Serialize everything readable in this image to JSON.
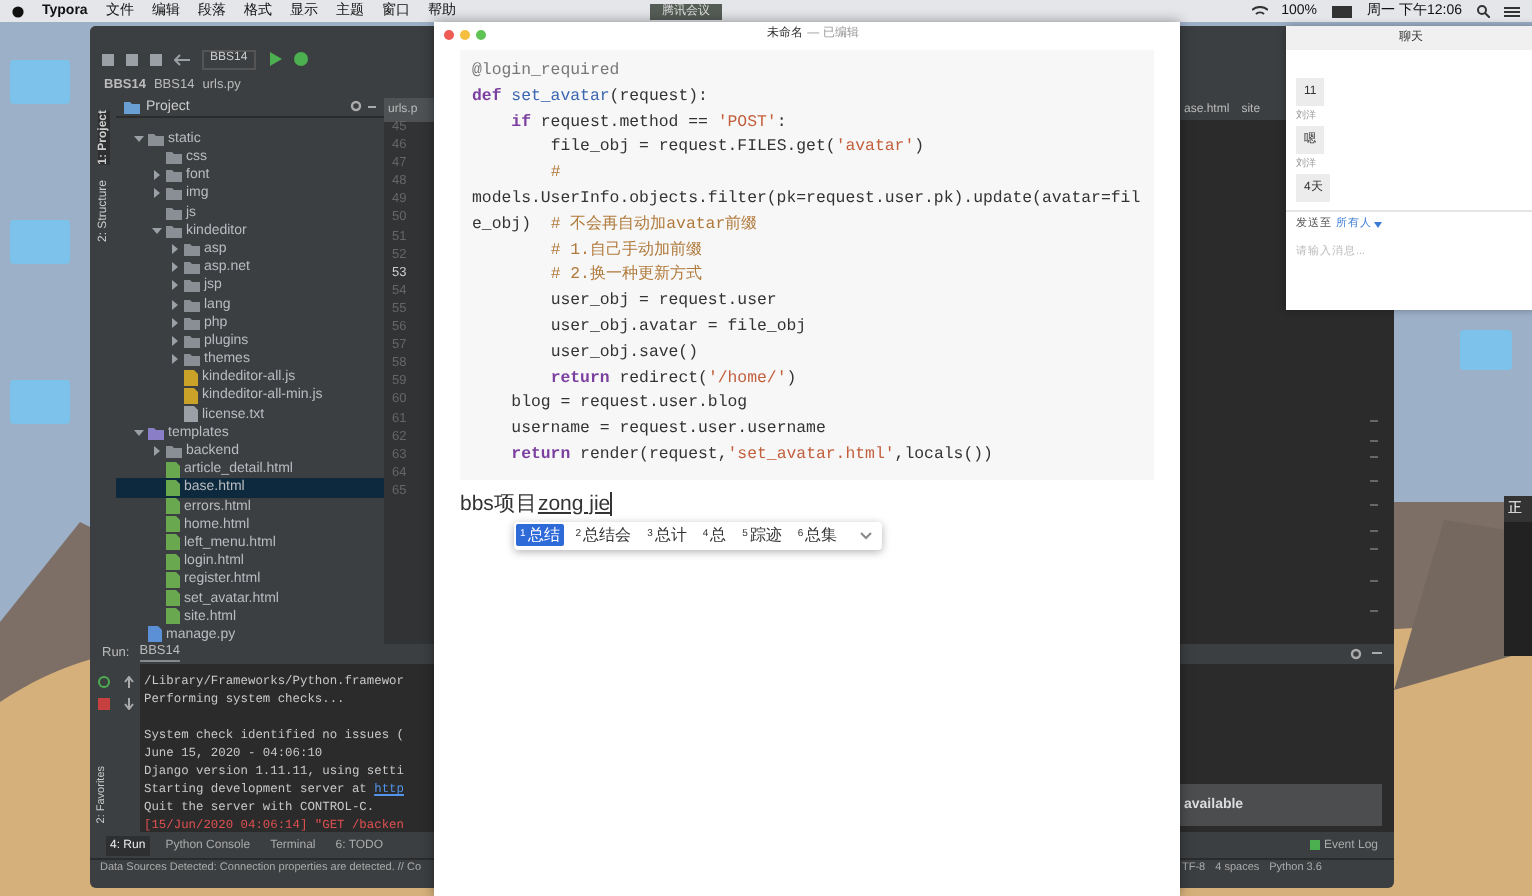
{
  "menu_bar": {
    "app": "Typora",
    "items": [
      "文件",
      "编辑",
      "段落",
      "格式",
      "显示",
      "主题",
      "窗口",
      "帮助"
    ],
    "meeting_badge": "腾讯会议",
    "battery": "100%",
    "clock": "周一 下午12:06"
  },
  "ide": {
    "breadcrumb": [
      "BBS14",
      "BBS14",
      "urls.py"
    ],
    "run_config": "BBS14",
    "project_title": "Project",
    "side_tabs": [
      "1: Project",
      "2: Structure"
    ],
    "favorites_tab": "2: Favorites",
    "tree": [
      {
        "name": "static",
        "kind": "folder",
        "expanded": true,
        "children": [
          {
            "name": "css",
            "kind": "folder"
          },
          {
            "name": "font",
            "kind": "folder",
            "expanded": false
          },
          {
            "name": "img",
            "kind": "folder",
            "expanded": false
          },
          {
            "name": "js",
            "kind": "folder"
          },
          {
            "name": "kindeditor",
            "kind": "folder",
            "expanded": true,
            "children": [
              {
                "name": "asp",
                "kind": "folder",
                "expanded": false
              },
              {
                "name": "asp.net",
                "kind": "folder",
                "expanded": false
              },
              {
                "name": "jsp",
                "kind": "folder",
                "expanded": false
              },
              {
                "name": "lang",
                "kind": "folder",
                "expanded": false
              },
              {
                "name": "php",
                "kind": "folder",
                "expanded": false
              },
              {
                "name": "plugins",
                "kind": "folder",
                "expanded": false
              },
              {
                "name": "themes",
                "kind": "folder",
                "expanded": false
              },
              {
                "name": "kindeditor-all.js",
                "kind": "js"
              },
              {
                "name": "kindeditor-all-min.js",
                "kind": "js"
              },
              {
                "name": "license.txt",
                "kind": "txt"
              }
            ]
          }
        ]
      },
      {
        "name": "templates",
        "kind": "folder",
        "expanded": true,
        "children": [
          {
            "name": "backend",
            "kind": "folder",
            "expanded": false
          },
          {
            "name": "article_detail.html",
            "kind": "html",
            "selected": false
          },
          {
            "name": "base.html",
            "kind": "html",
            "selected": true
          },
          {
            "name": "errors.html",
            "kind": "html",
            "selected": false
          },
          {
            "name": "home.html",
            "kind": "html",
            "selected": false
          },
          {
            "name": "left_menu.html",
            "kind": "html",
            "selected": false
          },
          {
            "name": "login.html",
            "kind": "html",
            "selected": false
          },
          {
            "name": "register.html",
            "kind": "html",
            "selected": false
          },
          {
            "name": "set_avatar.html",
            "kind": "html",
            "selected": false
          },
          {
            "name": "site.html",
            "kind": "html",
            "selected": false
          }
        ]
      },
      {
        "name": "manage.py",
        "kind": "py"
      }
    ],
    "editor_tab_left": "urls.p",
    "editor_tabs_right": [
      "ase.html",
      "site"
    ],
    "line_numbers": [
      "45",
      "46",
      "47",
      "48",
      "49",
      "50",
      "51",
      "52",
      "53",
      "54",
      "55",
      "56",
      "57",
      "58",
      "59",
      "60",
      "61",
      "62",
      "63",
      "64",
      "65"
    ],
    "run_label": "Run:",
    "run_tab": "BBS14",
    "console": [
      {
        "kind": "plain",
        "text": "/Library/Frameworks/Python.framewor"
      },
      {
        "kind": "plain",
        "text": "Performing system checks..."
      },
      {
        "kind": "blank"
      },
      {
        "kind": "plain",
        "text": "System check identified no issues ("
      },
      {
        "kind": "plain",
        "text": "June 15, 2020 - 04:06:10"
      },
      {
        "kind": "plain",
        "text": "Django version 1.11.11, using setti"
      },
      {
        "kind": "link",
        "text": "Starting development server at ",
        "link": "http"
      },
      {
        "kind": "plain",
        "text": "Quit the server with CONTROL-C."
      },
      {
        "kind": "error",
        "text": "[15/Jun/2020 04:06:14] \"GET /backen"
      }
    ],
    "bottom_tabs": [
      {
        "label": "4: Run",
        "selected": true
      },
      {
        "label": "Python Console",
        "selected": false
      },
      {
        "label": "Terminal",
        "selected": false
      },
      {
        "label": "6: TODO",
        "selected": false
      }
    ],
    "notification": "available",
    "event_log": "Event Log",
    "status_left": "Data Sources Detected: Connection properties are detected. // Co",
    "status_right": [
      "TF-8",
      "4 spaces",
      "Python 3.6"
    ]
  },
  "typora": {
    "title": "未命名",
    "title_state": "— 已编辑",
    "code": [
      [
        {
          "kind": "deco",
          "text": "@login_required"
        }
      ],
      [
        {
          "kind": "kw",
          "text": "def "
        },
        {
          "kind": "fn",
          "text": "set_avatar"
        },
        {
          "kind": "plain",
          "text": "(request):"
        }
      ],
      [
        {
          "kind": "kw",
          "text": "    if"
        },
        {
          "kind": "plain",
          "text": " request.method == "
        },
        {
          "kind": "str",
          "text": "'POST'"
        },
        {
          "kind": "plain",
          "text": ":"
        }
      ],
      [
        {
          "kind": "plain",
          "text": "        file_obj = request.FILES.get("
        },
        {
          "kind": "str",
          "text": "'avatar'"
        },
        {
          "kind": "plain",
          "text": ")"
        }
      ],
      [
        {
          "kind": "cmt",
          "text": "        #"
        }
      ],
      [
        {
          "kind": "plain",
          "text": "models.UserInfo.objects.filter(pk=request.user.pk).update(avatar=file_obj)  "
        },
        {
          "kind": "cmt",
          "text": "# 不会再自动加avatar前缀"
        }
      ],
      [
        {
          "kind": "cmt",
          "text": "        # 1.自己手动加前缀"
        }
      ],
      [
        {
          "kind": "cmt",
          "text": "        # 2.换一种更新方式"
        }
      ],
      [
        {
          "kind": "plain",
          "text": "        user_obj = request.user"
        }
      ],
      [
        {
          "kind": "plain",
          "text": "        user_obj.avatar = file_obj"
        }
      ],
      [
        {
          "kind": "plain",
          "text": "        user_obj.save()"
        }
      ],
      [
        {
          "kind": "kw",
          "text": "        return"
        },
        {
          "kind": "plain",
          "text": " redirect("
        },
        {
          "kind": "str",
          "text": "'/home/'"
        },
        {
          "kind": "plain",
          "text": ")"
        }
      ],
      [
        {
          "kind": "plain",
          "text": "    blog = request.user.blog"
        }
      ],
      [
        {
          "kind": "plain",
          "text": "    username = request.user.username"
        }
      ],
      [
        {
          "kind": "kw",
          "text": "    return"
        },
        {
          "kind": "plain",
          "text": " render(request,"
        },
        {
          "kind": "str",
          "text": "'set_avatar.html'"
        },
        {
          "kind": "plain",
          "text": ",locals())"
        }
      ]
    ],
    "paragraph": "bbs项目",
    "composing": "zong jie",
    "candidates": [
      {
        "num": "1",
        "text": "总结",
        "selected": true
      },
      {
        "num": "2",
        "text": "总结会",
        "selected": false
      },
      {
        "num": "3",
        "text": "总计",
        "selected": false
      },
      {
        "num": "4",
        "text": "总",
        "selected": false
      },
      {
        "num": "5",
        "text": "踪迹",
        "selected": false
      },
      {
        "num": "6",
        "text": "总集",
        "selected": false
      }
    ]
  },
  "chat": {
    "title": "聊天",
    "messages": [
      {
        "text": "11"
      },
      {
        "sender": "刘洋",
        "text": "嗯"
      },
      {
        "sender": "刘洋",
        "text": "4天"
      }
    ],
    "send_to_label": "发送至",
    "send_to": "所有人",
    "placeholder": "请输入消息..."
  },
  "meeting_window": {
    "title": "正"
  }
}
